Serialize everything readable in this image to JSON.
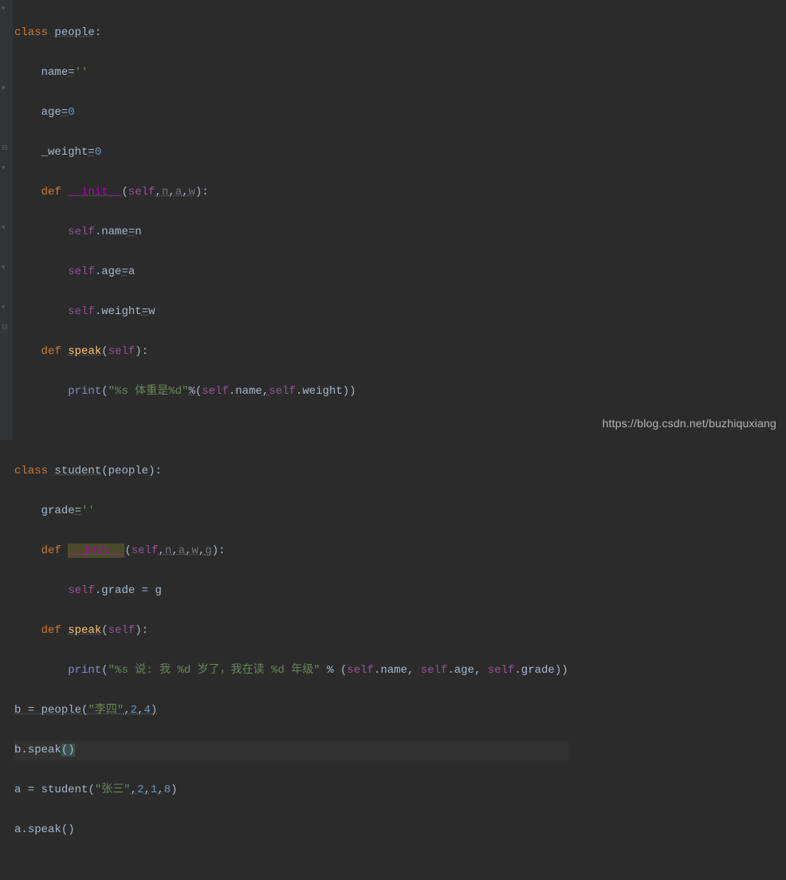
{
  "code": {
    "l1": {
      "class_kw": "class",
      "name": "people",
      "colon": ":"
    },
    "l2": {
      "attr": "name",
      "eq": "=",
      "val": "''"
    },
    "l3": {
      "attr": "age",
      "eq": "=",
      "val": "0"
    },
    "l4": {
      "attr": "_weight",
      "eq": "=",
      "val": "0"
    },
    "l5": {
      "def_kw": "def",
      "name": "__init__",
      "open": "(",
      "self": "self",
      "c1": ",",
      "p1": "n",
      "c2": ",",
      "p2": "a",
      "c3": ",",
      "p3": "w",
      "close": "):"
    },
    "l6": {
      "self": "self",
      "dot": ".",
      "attr": "name",
      "eq": "=",
      "rhs": "n"
    },
    "l7": {
      "self": "self",
      "dot": ".",
      "attr": "age",
      "eq": "=",
      "rhs": "a"
    },
    "l8": {
      "self": "self",
      "dot": ".",
      "attr": "weight",
      "eq": "=",
      "rhs": "w"
    },
    "l9": {
      "def_kw": "def",
      "name": "speak",
      "open": "(",
      "self": "self",
      "close": "):"
    },
    "l10": {
      "print": "print",
      "open": "(",
      "s1": "\"%s 体重是%d\"",
      "pct": "%",
      "po": "(",
      "self1": "self",
      "d1": ".",
      "a1": "name",
      "c1": ",",
      "self2": "self",
      "d2": ".",
      "a2": "weight",
      "pc": ")",
      "close": ")"
    },
    "l11": "",
    "l12": {
      "class_kw": "class",
      "name": "student",
      "open": "(",
      "base": "people",
      "close": "):"
    },
    "l13": {
      "attr": "grade",
      "eq": "=",
      "val": "''"
    },
    "l14": {
      "def_kw": "def",
      "name": "__init__",
      "open": "(",
      "self": "self",
      "c1": ",",
      "p1": "n",
      "c2": ",",
      "p2": "a",
      "c3": ",",
      "p3": "w",
      "c4": ",",
      "p4": "g",
      "close": "):"
    },
    "l15": {
      "self": "self",
      "dot": ".",
      "attr": "grade",
      "eq": " = ",
      "rhs": "g"
    },
    "l16": {
      "def_kw": "def",
      "name": "speak",
      "open": "(",
      "self": "self",
      "close": "):"
    },
    "l17": {
      "print": "print",
      "open": "(",
      "s1": "\"%s 说: 我 %d 岁了，我在读 %d 年级\"",
      "pct": " % ",
      "po": "(",
      "self1": "self",
      "d1": ".",
      "a1": "name",
      "c1": ", ",
      "self2": "self",
      "d2": ".",
      "a2": "age",
      "c2": ", ",
      "self3": "self",
      "d3": ".",
      "a3": "grade",
      "pc": ")",
      "close": ")"
    },
    "l18": {
      "var": "b",
      "eq": " = ",
      "cls": "people",
      "open": "(",
      "s": "\"李四\"",
      "c1": ",",
      "n1": "2",
      "c2": ",",
      "n2": "4",
      "close": ")"
    },
    "l19": {
      "var": "b",
      "dot": ".",
      "fn": "speak",
      "open": "(",
      "close": ")"
    },
    "l20": {
      "var": "a",
      "eq": " = ",
      "cls": "student",
      "open": "(",
      "s": "\"张三\"",
      "c1": ",",
      "n1": "2",
      "c2": ",",
      "n2": "1",
      "c3": ",",
      "n3": "8",
      "close": ")"
    },
    "l21": {
      "var": "a",
      "dot": ".",
      "fn": "speak",
      "open": "(",
      "close": ")"
    }
  },
  "watermark": "https://blog.csdn.net/buzhiquxiang"
}
